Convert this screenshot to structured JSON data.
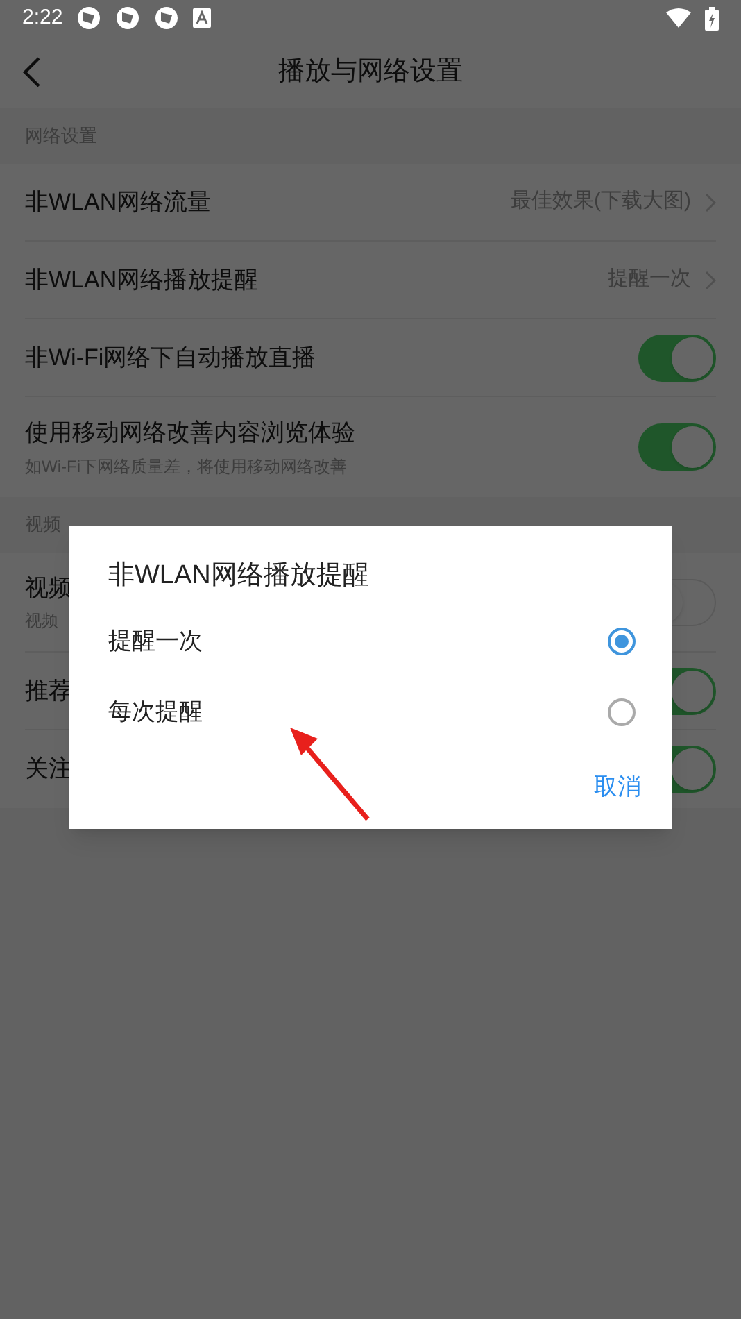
{
  "status_bar": {
    "time": "2:22"
  },
  "header": {
    "title": "播放与网络设置"
  },
  "sections": [
    {
      "title": "网络设置",
      "items": [
        {
          "kind": "value",
          "label": "非WLAN网络流量",
          "value": "最佳效果(下载大图)"
        },
        {
          "kind": "value",
          "label": "非WLAN网络播放提醒",
          "value": "提醒一次"
        },
        {
          "kind": "toggle",
          "label": "非Wi-Fi网络下自动播放直播",
          "on": true
        },
        {
          "kind": "toggle",
          "label": "使用移动网络改善内容浏览体验",
          "subtitle": "如Wi-Fi下网络质量差，将使用移动网络改善",
          "on": true
        }
      ]
    },
    {
      "title": "视频",
      "items": [
        {
          "kind": "toggle",
          "label": "视频",
          "subtitle": "视频",
          "on": false
        },
        {
          "kind": "toggle",
          "label": "推荐",
          "on": true
        },
        {
          "kind": "toggle",
          "label": "关注",
          "on": true
        }
      ]
    }
  ],
  "dialog": {
    "title": "非WLAN网络播放提醒",
    "options": [
      {
        "label": "提醒一次",
        "selected": true
      },
      {
        "label": "每次提醒",
        "selected": false
      }
    ],
    "cancel": "取消"
  }
}
